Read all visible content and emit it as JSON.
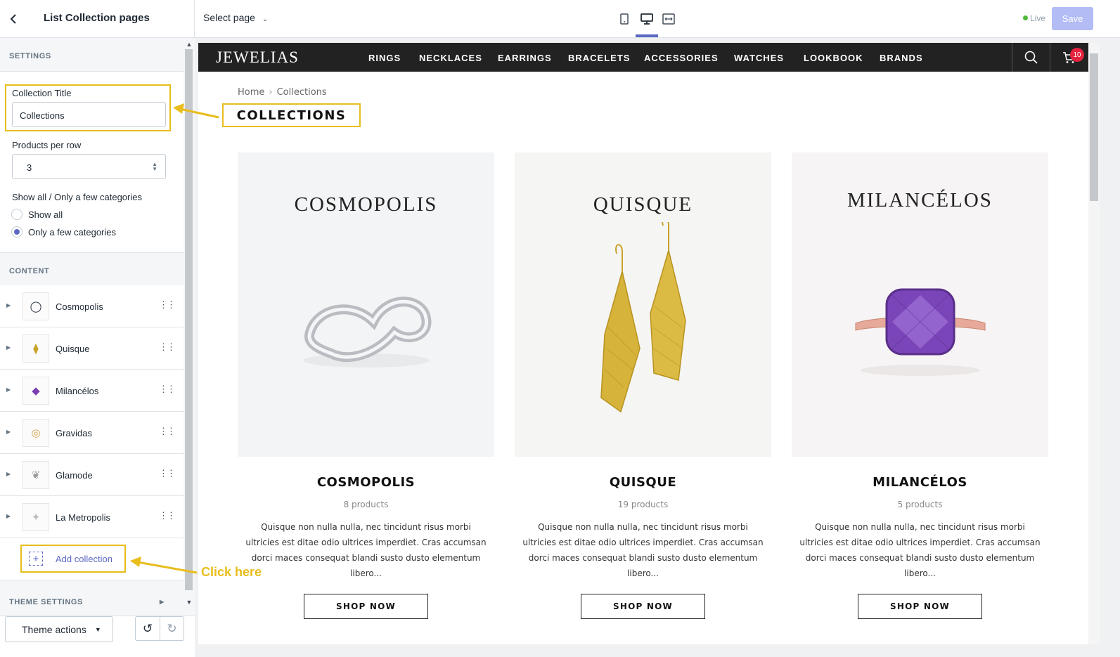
{
  "sidebar": {
    "title": "List Collection pages",
    "settings_heading": "SETTINGS",
    "collection_title_label": "Collection Title",
    "collection_title_value": "Collections",
    "products_per_row_label": "Products per row",
    "products_per_row_value": "3",
    "categories_label": "Show all / Only a few categories",
    "radio_options": [
      {
        "label": "Show all",
        "selected": false
      },
      {
        "label": "Only a few categories",
        "selected": true
      }
    ],
    "content_heading": "CONTENT",
    "content_items": [
      {
        "label": "Cosmopolis",
        "thumb_icon": "ring-icon"
      },
      {
        "label": "Quisque",
        "thumb_icon": "earrings-icon"
      },
      {
        "label": "Milancélos",
        "thumb_icon": "gem-ring-icon"
      },
      {
        "label": "Gravidas",
        "thumb_icon": "bracelet-icon"
      },
      {
        "label": "Glamode",
        "thumb_icon": "necklace-icon"
      },
      {
        "label": "La Metropolis",
        "thumb_icon": "jewelry-icon"
      }
    ],
    "add_collection_label": "Add collection",
    "theme_settings_heading": "THEME SETTINGS",
    "theme_actions_label": "Theme actions"
  },
  "topbar": {
    "select_page_label": "Select page",
    "live_label": "Live",
    "save_label": "Save",
    "device_icons": [
      "mobile-icon",
      "desktop-icon",
      "fullscreen-icon"
    ]
  },
  "shop": {
    "logo": "JEWELIAS",
    "nav": [
      "RINGS",
      "NECKLACES",
      "EARRINGS",
      "BRACELETS",
      "ACCESSORIES",
      "WATCHES",
      "LOOKBOOK",
      "BRANDS"
    ],
    "cart_count": "10",
    "breadcrumb_home": "Home",
    "breadcrumb_current": "Collections",
    "page_title": "COLLECTIONS",
    "collections": [
      {
        "image_title": "COSMOPOLIS",
        "name": "COSMOPOLIS",
        "count": "8 products",
        "desc": "Quisque non nulla nulla, nec tincidunt risus morbi ultricies est ditae odio ultrices imperdiet. Cras accumsan dorci maces consequat blandi susto dusto elementum libero...",
        "button": "SHOP NOW",
        "bg": "#f3f4f5"
      },
      {
        "image_title": "QUISQUE",
        "name": "QUISQUE",
        "count": "19 products",
        "desc": "Quisque non nulla nulla, nec tincidunt risus morbi ultricies est ditae odio ultrices imperdiet. Cras accumsan dorci maces consequat blandi susto dusto elementum libero...",
        "button": "SHOP NOW",
        "bg": "#f5f5f4"
      },
      {
        "image_title": "MILANCÉLOS",
        "name": "MILANCÉLOS",
        "count": "5 products",
        "desc": "Quisque non nulla nulla, nec tincidunt risus morbi ultricies est ditae odio ultrices imperdiet. Cras accumsan dorci maces consequat blandi susto dusto elementum libero...",
        "button": "SHOP NOW",
        "bg": "#f6f4f4"
      }
    ]
  },
  "annotations": {
    "click_here": "Click here",
    "highlight_color": "#e8bd1c"
  },
  "colors": {
    "accent": "#5c6ac4",
    "live": "#50b83c",
    "save_disabled": "#b3bcf5",
    "cart_badge": "#e3233f",
    "shop_nav_bg": "#222222"
  }
}
